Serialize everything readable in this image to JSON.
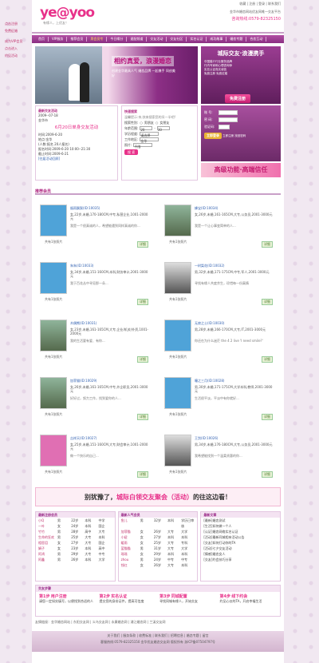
{
  "side_links": [
    "点击注册",
    "免费征婚",
    "成为VIP会员",
    "点击进入",
    "约见活动"
  ],
  "logo": {
    "text": "ye@yoo",
    "sub": "有缘人，上优友！",
    "cn": "优友"
  },
  "top": {
    "links": "收藏 | 注册 | 登录 | 联系我们",
    "tagline": "金华市婚恋网站优友网唯一交友平台",
    "hotline": "咨询热线:0579-82325150"
  },
  "nav": [
    "首页",
    "VIP服务",
    "推荐会员",
    "男会员专",
    "今日缘分",
    "速配频道",
    "交友活动",
    "交友社区",
    "实名认证",
    "成功故事",
    "婚恋专题",
    "合恋互动"
  ],
  "banner": {
    "title": "相约真爱，浪漫婚恋",
    "sub": "创建金华最具人气 婚恋品牌 一起携手 同创美好"
  },
  "promo": {
    "title": "城际交友·浪漫携手",
    "items": [
      "中国婚介行业服务品牌",
      "行内专家和心理咨询师",
      "实名认证真实诚信",
      "免费注册 免费征婚"
    ],
    "btn": "免费注册"
  },
  "login": {
    "user_label": "账 号:",
    "pwd_label": "密 码:",
    "code_label": "验证码:",
    "btn": "立即登录",
    "extra": "立即注册",
    "forget": "找回密码"
  },
  "smallbanner": "高级功能·高端信任",
  "activity": {
    "title": "最新交友活动",
    "date": "2009--07-18",
    "place": "金华市",
    "name": "6月20日单身交友活动",
    "lines": [
      "时间:2009-6-20",
      "地点:金华",
      "(人数:报名 20人报名)",
      "报名时间:2009-6-20 10:00--21:30",
      "截止时间:2009-6-21"
    ],
    "more": "[往届活动回顾]"
  },
  "search": {
    "title": "快速搜索",
    "note": "温馨提示:亲,快来搜索您的另一半吧!",
    "gender_label": "搜索性别:",
    "male": "男朋友",
    "female": "女朋友",
    "age_label": "年龄范围:",
    "age_from": "20",
    "age_to": "30",
    "edu_label": "学历程度:",
    "edu": "请选择",
    "city_label": "工作地区:",
    "city": "金华",
    "photo_label": "照片:",
    "photo": "不限",
    "btn": "搜 索"
  },
  "section_title": "推荐会员",
  "members": [
    {
      "name": "烟雨飘絮",
      "id": "(ID:10035)",
      "info": "女,22岁,未婚,170-180CM,中专,私营企业,1001-2000元",
      "desc": "我是一个很真诚的人，希望能遇到同样真诚的你...",
      "ph": "共有1张照片"
    },
    {
      "name": "蜂宝",
      "id": "(ID:10034)",
      "info": "女,26岁,未婚,161-165CM,大专,公务员,2001-3000元",
      "desc": "我是一个让心事变简单的人...",
      "ph": "共有1张照片"
    },
    {
      "name": "朱朱",
      "id": "(ID:10033)",
      "info": "女,34岁,未婚,151-160CM,本科,财务审计,2001-3000元",
      "desc": "我于百花丛中寻觅那一朵...",
      "ph": "共有1张照片"
    },
    {
      "name": "一树梨花",
      "id": "(ID:10032)",
      "info": "男,32岁,未婚,171-175CM,中专,军人,2001-3000元",
      "desc": "寻找有缘人共度余生，珍惜每一份真情",
      "ph": "共有1张照片"
    },
    {
      "name": "木偶熊",
      "id": "(ID:10031)",
      "info": "女,23岁,未婚,161-165CM,大专,企业/机关/外资,1001-2000元",
      "desc": "我的生活要有爱、有你...",
      "ph": "共有1张照片"
    },
    {
      "name": "无寂之士",
      "id": "(ID:10030)",
      "info": "男,28岁,未婚,166-170CM,大专,IT,2001-3000元",
      "desc": "你还在为什么迷茫 the 4 2 live 'I need smile?'",
      "ph": "共有1张照片"
    },
    {
      "name": "加菲猫",
      "id": "(ID:10029)",
      "info": "女,26岁,未婚,161-165CM,中专,外企职员,2001-3000元",
      "desc": "好好过，努力工作，找到爱你的人...",
      "ph": "共有1张照片"
    },
    {
      "name": "瞳之三月",
      "id": "(ID:10028)",
      "info": "男,30岁,未婚,171-175CM,大学本科,教师,2001-3000元",
      "desc": "生活很平淡，平淡中有你就好...",
      "ph": "共有1张照片"
    },
    {
      "name": "吉祥天",
      "id": "(ID:10027)",
      "info": "女,25岁,未婚,151-160CM,大专,财会审计,1001-2000元",
      "desc": "做一个快乐的自己...",
      "ph": "共有1张照片"
    },
    {
      "name": "王剑",
      "id": "(ID:10026)",
      "info": "男,34岁,未婚,176-180CM,大专,公务员,2001-3000元",
      "desc": "我希望能找到一个温柔贤惠的你...",
      "ph": "共有1张照片"
    }
  ],
  "detail_label": "详细",
  "adbar": {
    "pre": "别犹豫了，",
    "main": "城际白领交友聚会（活动）",
    "post": "的往这边看！"
  },
  "lists": {
    "c1": {
      "title": "最新注册会员",
      "rows": [
        [
          "小Q",
          "男",
          "22岁",
          "本科",
          "中学"
        ],
        [
          "一叶",
          "女",
          "24岁",
          "本科",
          "国企"
        ],
        [
          "竹竹",
          "男",
          "28岁",
          "高中",
          "大专"
        ],
        [
          "生命的狂欢",
          "男",
          "25岁",
          "大专",
          "本科"
        ],
        [
          "相思泪",
          "女",
          "27岁",
          "大专",
          "国企"
        ],
        [
          "娟子",
          "女",
          "23岁",
          "本科",
          "高中"
        ],
        [
          "阿鸿",
          "男",
          "29岁",
          "大专",
          "中专"
        ],
        [
          "阿鑫",
          "男",
          "26岁",
          "本科",
          "大学"
        ]
      ]
    },
    "c2": {
      "title": "最新人气会员",
      "rows": [
        [
          "鱼儿",
          "男",
          "32岁",
          "本科",
          "学历已审核"
        ],
        [
          "加菲猫",
          "女",
          "26岁",
          "大专",
          "大学"
        ],
        [
          "小妞",
          "女",
          "27岁",
          "本科",
          "本科"
        ],
        [
          "暖雨",
          "女",
          "25岁",
          "大专",
          "专科"
        ],
        [
          "蓝猫猫",
          "男",
          "31岁",
          "大专",
          "大学"
        ],
        [
          "瑶瑶",
          "女",
          "29岁",
          "本科",
          "本科"
        ],
        [
          "zhou",
          "男",
          "24岁",
          "中专",
          "中专"
        ],
        [
          "钱红",
          "女",
          "26岁",
          "大专",
          "本科"
        ]
      ]
    },
    "c3": {
      "title": "最新文章",
      "rows": [
        "[最新]婚恋测试",
        "[生活]如何做一个人",
        "[认证]婚恋网络实名认证",
        "[活动]最新同城相亲活动公告",
        "[交友]如何打动你的TA",
        "[活动]七夕交友活动",
        "[情感]婚恋女人",
        "[交友]约会技巧分享"
      ]
    }
  },
  "steps": {
    "title": "交友步骤",
    "items": [
      {
        "n": "第1步",
        "t": "用户注册",
        "d": "请您一定如实填写，以便找到合适的人"
      },
      {
        "n": "第2步",
        "t": "实名认证",
        "d": "提交您的身份证件，提高可信度"
      },
      {
        "n": "第3步",
        "t": "同城配置",
        "d": "寻找同城有缘人，开始交友"
      },
      {
        "n": "第4步",
        "t": "线下约会",
        "d": "约见心仪的TA，开启幸福生活"
      }
    ]
  },
  "friendly": "友情链接：金华婚恋网站 | 东阳交友网 | 义乌交友网 | 永康婚恋网 | 浦江婚恋网 | 兰溪交友网",
  "footer": {
    "links": "关于我们 | 服务条款 | 收费标准 | 联系我们 | 招聘信息 | 婚恋专题 | 留言",
    "copy": "客服热线:0579-82325150 金华优友婚恋交友网 版权所有 浙ICP备07504797号"
  }
}
